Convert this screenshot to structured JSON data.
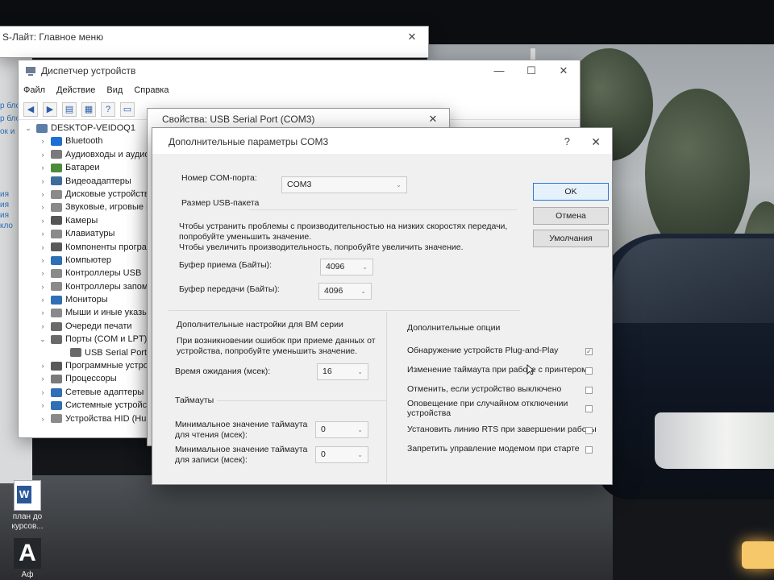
{
  "background_window": {
    "title": "S-Лайт: Главное меню",
    "close": "✕"
  },
  "left_strip": [
    "р бло",
    "р бло",
    "ок и",
    "",
    "",
    "ия",
    "ия",
    "ия",
    "кло"
  ],
  "device_manager": {
    "title": "Диспетчер устройств",
    "controls": {
      "minimize": "—",
      "maximize": "☐",
      "close": "✕"
    },
    "menu": [
      "Файл",
      "Действие",
      "Вид",
      "Справка"
    ],
    "tree": [
      {
        "label": "DESKTOP-VEIDOQ1",
        "level": 0,
        "expanded": true,
        "color": "#5a7ea8"
      },
      {
        "label": "Bluetooth",
        "level": 1,
        "color": "#1e6fd1"
      },
      {
        "label": "Аудиовходы и аудиов",
        "level": 1,
        "color": "#7a7a7a"
      },
      {
        "label": "Батареи",
        "level": 1,
        "color": "#4a8a3a"
      },
      {
        "label": "Видеоадаптеры",
        "level": 1,
        "color": "#3c6d9b"
      },
      {
        "label": "Дисковые устройства",
        "level": 1,
        "color": "#8a8a8a"
      },
      {
        "label": "Звуковые, игровые и в",
        "level": 1,
        "color": "#8a8a8a"
      },
      {
        "label": "Камеры",
        "level": 1,
        "color": "#555555"
      },
      {
        "label": "Клавиатуры",
        "level": 1,
        "color": "#8a8a8a"
      },
      {
        "label": "Компоненты программ",
        "level": 1,
        "color": "#5a5a5a"
      },
      {
        "label": "Компьютер",
        "level": 1,
        "color": "#2f6fb5"
      },
      {
        "label": "Контроллеры USB",
        "level": 1,
        "color": "#8a8a8a"
      },
      {
        "label": "Контроллеры запомин",
        "level": 1,
        "color": "#8a8a8a"
      },
      {
        "label": "Мониторы",
        "level": 1,
        "color": "#2f6fb5"
      },
      {
        "label": "Мыши и иные указыва",
        "level": 1,
        "color": "#8a8a8a"
      },
      {
        "label": "Очереди печати",
        "level": 1,
        "color": "#6a6a6a"
      },
      {
        "label": "Порты (COM и LPT)",
        "level": 1,
        "expanded": true,
        "color": "#6a6a6a"
      },
      {
        "label": "USB Serial Port (COM",
        "level": 2,
        "color": "#6a6a6a"
      },
      {
        "label": "Программные устройс",
        "level": 1,
        "color": "#5a5a5a"
      },
      {
        "label": "Процессоры",
        "level": 1,
        "color": "#7a7a7a"
      },
      {
        "label": "Сетевые адаптеры",
        "level": 1,
        "color": "#2f6fb5"
      },
      {
        "label": "Системные устройства",
        "level": 1,
        "color": "#2f6fb5"
      },
      {
        "label": "Устройства HID (Humai",
        "level": 1,
        "color": "#8a8a8a"
      }
    ]
  },
  "properties_window": {
    "title": "Свойства: USB Serial Port (COM3)",
    "close": "✕"
  },
  "dialog": {
    "title": "Дополнительные параметры COM3",
    "help": "?",
    "close": "✕",
    "port_label": "Номер COM-порта:",
    "port_value": "COM3",
    "usb_group": "Размер USB-пакета",
    "usb_text_1": "Чтобы устранить проблемы с производительностью на низких скоростях передачи,",
    "usb_text_2": "попробуйте уменьшить значение.",
    "usb_text_3": "Чтобы увеличить производительность, попробуйте увеличить значение.",
    "rx_label": "Буфер приема (Байты):",
    "rx_value": "4096",
    "tx_label": "Буфер передачи (Байты):",
    "tx_value": "4096",
    "bm_group": "Дополнительные настройки для BM серии",
    "bm_text_1": "При возникновении ошибок при приеме данных от",
    "bm_text_2": "устройства, попробуйте уменьшить значение.",
    "latency_label": "Время ожидания (мсек):",
    "latency_value": "16",
    "timeouts_group": "Таймауты",
    "read_timeout_label_1": "Минимальное значение таймаута",
    "read_timeout_label_2": "для чтения (мсек):",
    "read_timeout_value": "0",
    "write_timeout_label_1": "Минимальное значение таймаута",
    "write_timeout_label_2": "для записи (мсек):",
    "write_timeout_value": "0",
    "options_group": "Дополнительные опции",
    "options": [
      {
        "label": "Обнаружение устройств Plug-and-Play",
        "checked": true
      },
      {
        "label": "Изменение таймаута при работе с принтером",
        "checked": false
      },
      {
        "label": "Отменить, если устройство выключено",
        "checked": false
      },
      {
        "label": "Оповещение при случайном отключении",
        "label2": "устройства",
        "checked": false
      },
      {
        "label": "Установить линию RTS при завершении работы",
        "checked": false
      },
      {
        "label": "Запретить управление модемом при старте",
        "checked": false
      }
    ],
    "ok": "OK",
    "cancel": "Отмена",
    "defaults": "Умолчания"
  },
  "desktop_icons": [
    {
      "label_1": "план до",
      "label_2": "курсов..."
    },
    {
      "label_1": "Аф",
      "label_2": ""
    }
  ]
}
